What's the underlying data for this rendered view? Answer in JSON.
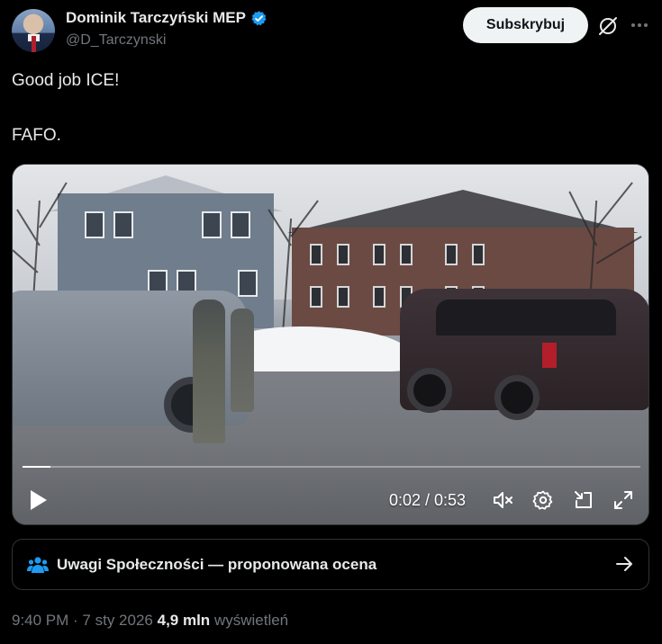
{
  "author": {
    "name": "Dominik Tarczyński MEP",
    "handle": "@D_Tarczynski",
    "verified": true,
    "avatar_icon": "profile-photo"
  },
  "header": {
    "subscribe_label": "Subskrybuj",
    "grok_icon": "grok-icon",
    "more_icon": "more-icon"
  },
  "tweet": {
    "lines": [
      "Good job ICE!",
      "FAFO."
    ]
  },
  "video": {
    "current_time": "0:02",
    "duration": "0:53",
    "time_display": "0:02 / 0:53",
    "progress_fraction": 0.045,
    "icons": [
      "play-icon",
      "mute-icon",
      "settings-icon",
      "dock-icon",
      "fullscreen-icon"
    ]
  },
  "community_notes": {
    "label": "Uwagi Społeczności — proponowana ocena",
    "icon": "people-icon",
    "arrow_icon": "arrow-right-icon"
  },
  "meta": {
    "time": "9:40 PM",
    "separator": " · ",
    "date": "7 sty 2026",
    "views_count": "4,9 mln",
    "views_label": "wyświetleń"
  },
  "colors": {
    "background": "#000000",
    "text": "#e7e9ea",
    "secondary_text": "#71767b",
    "accent": "#1d9bf0",
    "border": "#2f3336"
  }
}
